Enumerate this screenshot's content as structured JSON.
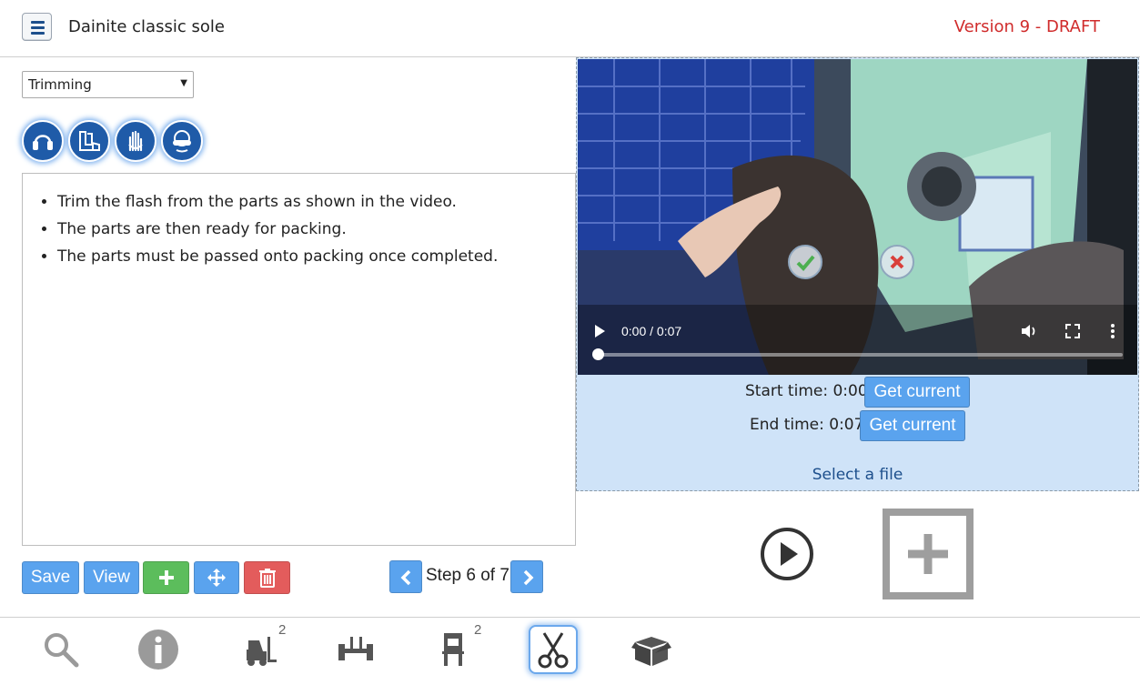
{
  "header": {
    "title": "Dainite classic sole",
    "version": "Version 9 - DRAFT",
    "colors": {
      "version": "#d02b2b",
      "accent": "#1d4f8c"
    }
  },
  "step_select": {
    "value": "Trimming"
  },
  "ppe_icons": [
    "ear-protection-icon",
    "safety-boots-icon",
    "gloves-icon",
    "safety-glasses-icon"
  ],
  "instructions": [
    "Trim the flash from the parts as shown in the video.",
    "The parts are then ready for packing.",
    "The parts must be passed onto packing once completed."
  ],
  "actions": {
    "save_label": "Save",
    "view_label": "View"
  },
  "step_nav": {
    "label": "Step 6 of 7"
  },
  "video": {
    "time_readout": "0:00 / 0:07",
    "progress": 0.0
  },
  "trim": {
    "start_label": "Start time: 0:00",
    "end_label": "End time: 0:07",
    "get_current_label": "Get current",
    "select_file_label": "Select a file"
  },
  "toolbar": {
    "items": [
      {
        "name": "search-icon",
        "count": ""
      },
      {
        "name": "info-icon",
        "count": ""
      },
      {
        "name": "forklift-icon",
        "count": "2"
      },
      {
        "name": "conveyor-icon",
        "count": ""
      },
      {
        "name": "press-machine-icon",
        "count": "2"
      },
      {
        "name": "scissors-icon",
        "count": ""
      },
      {
        "name": "box-icon",
        "count": ""
      }
    ],
    "counts": {
      "forklift": "2",
      "press": "2"
    }
  }
}
